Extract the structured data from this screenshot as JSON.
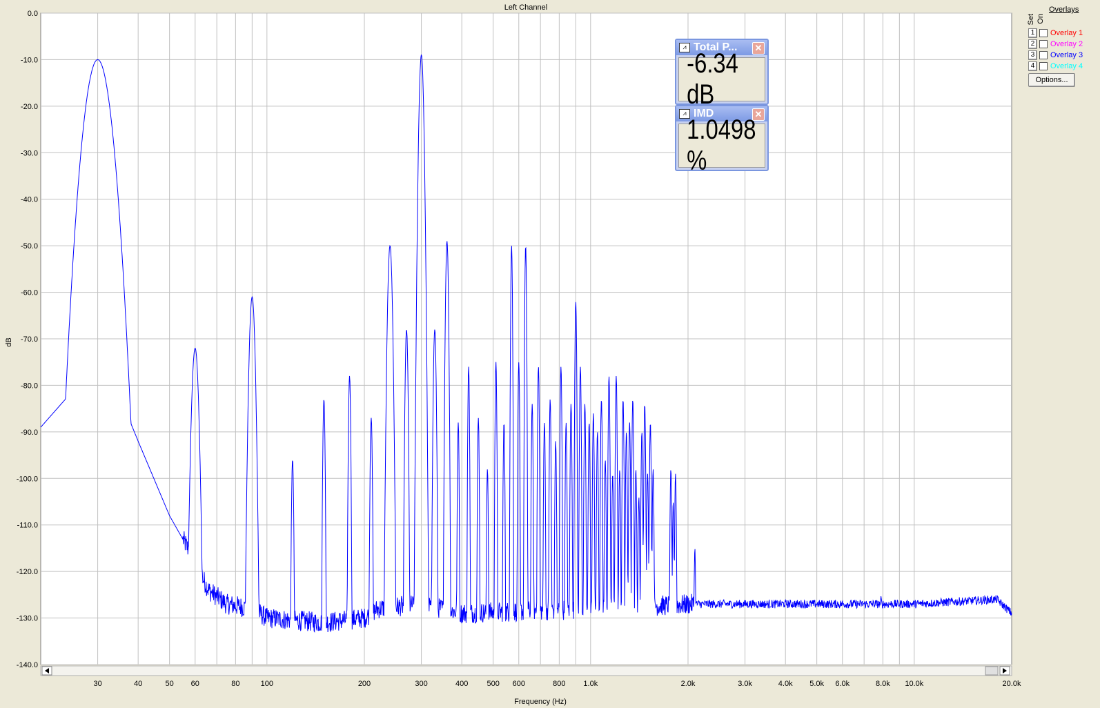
{
  "chart_data": {
    "type": "line",
    "title": "Left Channel",
    "xlabel": "Frequency (Hz)",
    "ylabel": "dB",
    "xscale": "log",
    "xlim": [
      20,
      20000
    ],
    "ylim": [
      -140,
      0
    ],
    "yticks": [
      "0.0",
      "-10.0",
      "-20.0",
      "-30.0",
      "-40.0",
      "-50.0",
      "-60.0",
      "-70.0",
      "-80.0",
      "-90.0",
      "-100.0",
      "-110.0",
      "-120.0",
      "-130.0",
      "-140.0"
    ],
    "xticks": [
      {
        "v": 30,
        "t": "30"
      },
      {
        "v": 40,
        "t": "40"
      },
      {
        "v": 50,
        "t": "50"
      },
      {
        "v": 60,
        "t": "60"
      },
      {
        "v": 80,
        "t": "80"
      },
      {
        "v": 100,
        "t": "100"
      },
      {
        "v": 200,
        "t": "200"
      },
      {
        "v": 300,
        "t": "300"
      },
      {
        "v": 400,
        "t": "400"
      },
      {
        "v": 500,
        "t": "500"
      },
      {
        "v": 600,
        "t": "600"
      },
      {
        "v": 800,
        "t": "800"
      },
      {
        "v": 1000,
        "t": "1.0k"
      },
      {
        "v": 2000,
        "t": "2.0k"
      },
      {
        "v": 3000,
        "t": "3.0k"
      },
      {
        "v": 4000,
        "t": "4.0k"
      },
      {
        "v": 5000,
        "t": "5.0k"
      },
      {
        "v": 6000,
        "t": "6.0k"
      },
      {
        "v": 8000,
        "t": "8.0k"
      },
      {
        "v": 10000,
        "t": "10.0k"
      },
      {
        "v": 20000,
        "t": "20.0k"
      }
    ],
    "grid": true,
    "line_color": "#0000ff",
    "baseline": [
      [
        20,
        -89
      ],
      [
        26,
        -80
      ],
      [
        29,
        -45
      ],
      [
        30,
        -10
      ],
      [
        31,
        -45
      ],
      [
        34,
        -80
      ],
      [
        40,
        -92
      ],
      [
        50,
        -108
      ],
      [
        57,
        -115
      ],
      [
        60,
        -118
      ],
      [
        66,
        -124
      ],
      [
        75,
        -127
      ],
      [
        90,
        -128
      ],
      [
        100,
        -130
      ],
      [
        150,
        -131
      ],
      [
        200,
        -130
      ],
      [
        220,
        -128
      ],
      [
        300,
        -127
      ],
      [
        400,
        -129
      ],
      [
        1000,
        -128
      ],
      [
        2100,
        -127
      ],
      [
        5000,
        -127
      ],
      [
        10000,
        -127
      ],
      [
        18000,
        -126
      ],
      [
        20000,
        -129
      ]
    ],
    "peaks": [
      {
        "f": 30,
        "db": -10,
        "w": 0.045
      },
      {
        "f": 60,
        "db": -72,
        "w": 0.012
      },
      {
        "f": 90,
        "db": -61,
        "w": 0.01
      },
      {
        "f": 120,
        "db": -96,
        "w": 0.004
      },
      {
        "f": 150,
        "db": -83,
        "w": 0.004
      },
      {
        "f": 180,
        "db": -78,
        "w": 0.004
      },
      {
        "f": 210,
        "db": -87,
        "w": 0.004
      },
      {
        "f": 240,
        "db": -50,
        "w": 0.008
      },
      {
        "f": 270,
        "db": -68,
        "w": 0.005
      },
      {
        "f": 300,
        "db": -9,
        "w": 0.008
      },
      {
        "f": 330,
        "db": -68,
        "w": 0.005
      },
      {
        "f": 360,
        "db": -49,
        "w": 0.005
      },
      {
        "f": 390,
        "db": -88,
        "w": 0.003
      },
      {
        "f": 420,
        "db": -76,
        "w": 0.003
      },
      {
        "f": 450,
        "db": -87,
        "w": 0.003
      },
      {
        "f": 480,
        "db": -98,
        "w": 0.003
      },
      {
        "f": 510,
        "db": -75,
        "w": 0.003
      },
      {
        "f": 540,
        "db": -88,
        "w": 0.003
      },
      {
        "f": 570,
        "db": -50,
        "w": 0.003
      },
      {
        "f": 600,
        "db": -75,
        "w": 0.003
      },
      {
        "f": 630,
        "db": -50,
        "w": 0.003
      },
      {
        "f": 660,
        "db": -84,
        "w": 0.003
      },
      {
        "f": 690,
        "db": -76,
        "w": 0.003
      },
      {
        "f": 720,
        "db": -88,
        "w": 0.003
      },
      {
        "f": 750,
        "db": -83,
        "w": 0.003
      },
      {
        "f": 780,
        "db": -92,
        "w": 0.003
      },
      {
        "f": 810,
        "db": -76,
        "w": 0.003
      },
      {
        "f": 840,
        "db": -88,
        "w": 0.003
      },
      {
        "f": 870,
        "db": -84,
        "w": 0.003
      },
      {
        "f": 900,
        "db": -62,
        "w": 0.003
      },
      {
        "f": 930,
        "db": -76,
        "w": 0.003
      },
      {
        "f": 960,
        "db": -84,
        "w": 0.003
      },
      {
        "f": 990,
        "db": -88,
        "w": 0.003
      },
      {
        "f": 1020,
        "db": -86,
        "w": 0.003
      },
      {
        "f": 1050,
        "db": -90,
        "w": 0.003
      },
      {
        "f": 1080,
        "db": -83,
        "w": 0.003
      },
      {
        "f": 1110,
        "db": -96,
        "w": 0.003
      },
      {
        "f": 1140,
        "db": -78,
        "w": 0.003
      },
      {
        "f": 1170,
        "db": -99,
        "w": 0.003
      },
      {
        "f": 1200,
        "db": -78,
        "w": 0.003
      },
      {
        "f": 1230,
        "db": -98,
        "w": 0.003
      },
      {
        "f": 1260,
        "db": -83,
        "w": 0.003
      },
      {
        "f": 1290,
        "db": -90,
        "w": 0.003
      },
      {
        "f": 1320,
        "db": -88,
        "w": 0.003
      },
      {
        "f": 1350,
        "db": -83,
        "w": 0.003
      },
      {
        "f": 1380,
        "db": -98,
        "w": 0.003
      },
      {
        "f": 1410,
        "db": -104,
        "w": 0.003
      },
      {
        "f": 1440,
        "db": -90,
        "w": 0.003
      },
      {
        "f": 1470,
        "db": -84,
        "w": 0.003
      },
      {
        "f": 1500,
        "db": -99,
        "w": 0.003
      },
      {
        "f": 1530,
        "db": -88,
        "w": 0.003
      },
      {
        "f": 1560,
        "db": -98,
        "w": 0.003
      },
      {
        "f": 1770,
        "db": -98,
        "w": 0.003
      },
      {
        "f": 1800,
        "db": -105,
        "w": 0.003
      },
      {
        "f": 1830,
        "db": -99,
        "w": 0.003
      },
      {
        "f": 2100,
        "db": -115,
        "w": 0.003
      },
      {
        "f": 7900,
        "db": -125,
        "w": 0.003
      }
    ]
  },
  "overlays": {
    "title": "Overlays",
    "set_label": "Set",
    "on_label": "On",
    "items": [
      {
        "num": "1",
        "label": "Overlay 1",
        "color": "#ff0000"
      },
      {
        "num": "2",
        "label": "Overlay 2",
        "color": "#ff00ff"
      },
      {
        "num": "3",
        "label": "Overlay 3",
        "color": "#0000ff"
      },
      {
        "num": "4",
        "label": "Overlay 4",
        "color": "#00ffff"
      }
    ],
    "options_label": "Options..."
  },
  "meters": {
    "total_power": {
      "title": "Total P...",
      "value": "-6.34 dB"
    },
    "imd": {
      "title": "IMD",
      "value": "1.0498 %"
    }
  }
}
